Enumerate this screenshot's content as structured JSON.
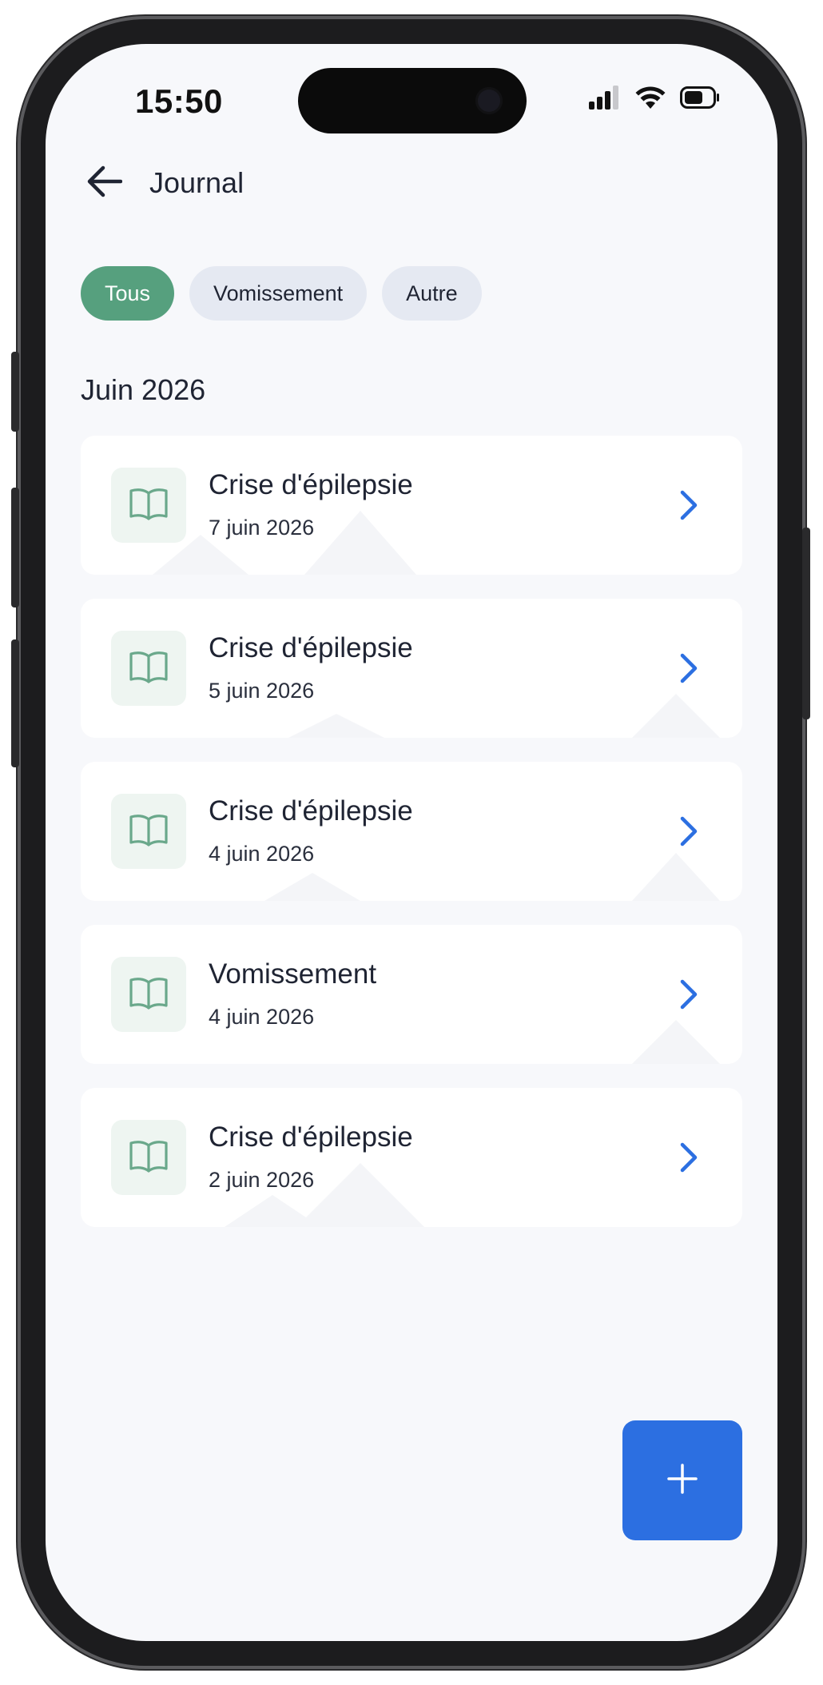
{
  "status_bar": {
    "time": "15:50",
    "icons": [
      "cellular-signal-icon",
      "wifi-icon",
      "battery-icon"
    ]
  },
  "header": {
    "back_icon": "arrow-left-icon",
    "title": "Journal"
  },
  "filters": [
    {
      "label": "Tous",
      "active": true
    },
    {
      "label": "Vomissement",
      "active": false
    },
    {
      "label": "Autre",
      "active": false
    }
  ],
  "section": {
    "title": "Juin 2026"
  },
  "entries": [
    {
      "title": "Crise d'épilepsie",
      "date": "7 juin 2026",
      "icon": "book-open-icon"
    },
    {
      "title": "Crise d'épilepsie",
      "date": "5 juin 2026",
      "icon": "book-open-icon"
    },
    {
      "title": "Crise d'épilepsie",
      "date": "4 juin 2026",
      "icon": "book-open-icon"
    },
    {
      "title": "Vomissement",
      "date": "4 juin 2026",
      "icon": "book-open-icon"
    },
    {
      "title": "Crise d'épilepsie",
      "date": "2 juin 2026",
      "icon": "book-open-icon"
    }
  ],
  "fab": {
    "icon": "plus-icon"
  },
  "colors": {
    "accent_green": "#56a07e",
    "chip_inactive": "#e5e9f2",
    "primary_blue": "#2c6fe1",
    "background": "#f7f8fb",
    "text": "#1f2433"
  }
}
